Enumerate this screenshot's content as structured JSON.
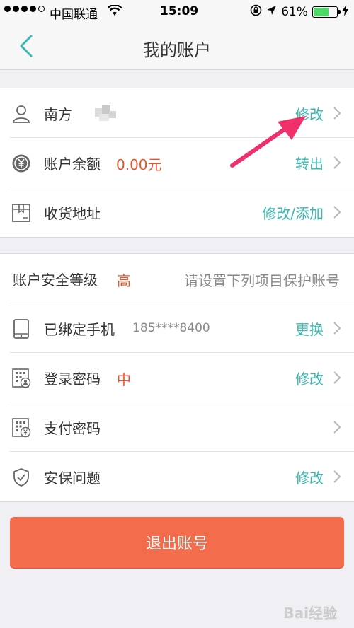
{
  "status_bar": {
    "carrier": "中国联通",
    "time": "15:09",
    "battery": "61%",
    "battery_level": 0.61,
    "icons": [
      "signal-dots-icon",
      "wifi-icon",
      "orientation-lock-icon",
      "location-icon",
      "battery-icon",
      "charging-icon"
    ]
  },
  "nav": {
    "back_icon": "chevron-left-icon",
    "title": "我的账户"
  },
  "account_group": [
    {
      "icon": "user-icon",
      "label": "南方",
      "action": "修改"
    },
    {
      "icon": "yuan-coin-icon",
      "label": "账户余额",
      "value": "0.00元",
      "action": "转出"
    },
    {
      "icon": "box-icon",
      "label": "收货地址",
      "action": "修改/添加"
    }
  ],
  "security_group": {
    "level_label": "账户安全等级",
    "level_value": "高",
    "hint": "请设置下列项目保护账号",
    "items": [
      {
        "icon": "phone-icon",
        "label": "已绑定手机",
        "value": "185****8400",
        "action": "更换"
      },
      {
        "icon": "keypad-user-icon",
        "label": "登录密码",
        "value": "中",
        "action": "修改"
      },
      {
        "icon": "keypad-yuan-icon",
        "label": "支付密码",
        "action": ""
      },
      {
        "icon": "shield-check-icon",
        "label": "安保问题",
        "action": "修改"
      }
    ]
  },
  "logout_label": "退出账号",
  "watermark": "Bai经验",
  "colors": {
    "accent": "#3bb8b0",
    "warning": "#e8542c",
    "button": "#f36d4c",
    "annotation_arrow": "#f0306a"
  }
}
